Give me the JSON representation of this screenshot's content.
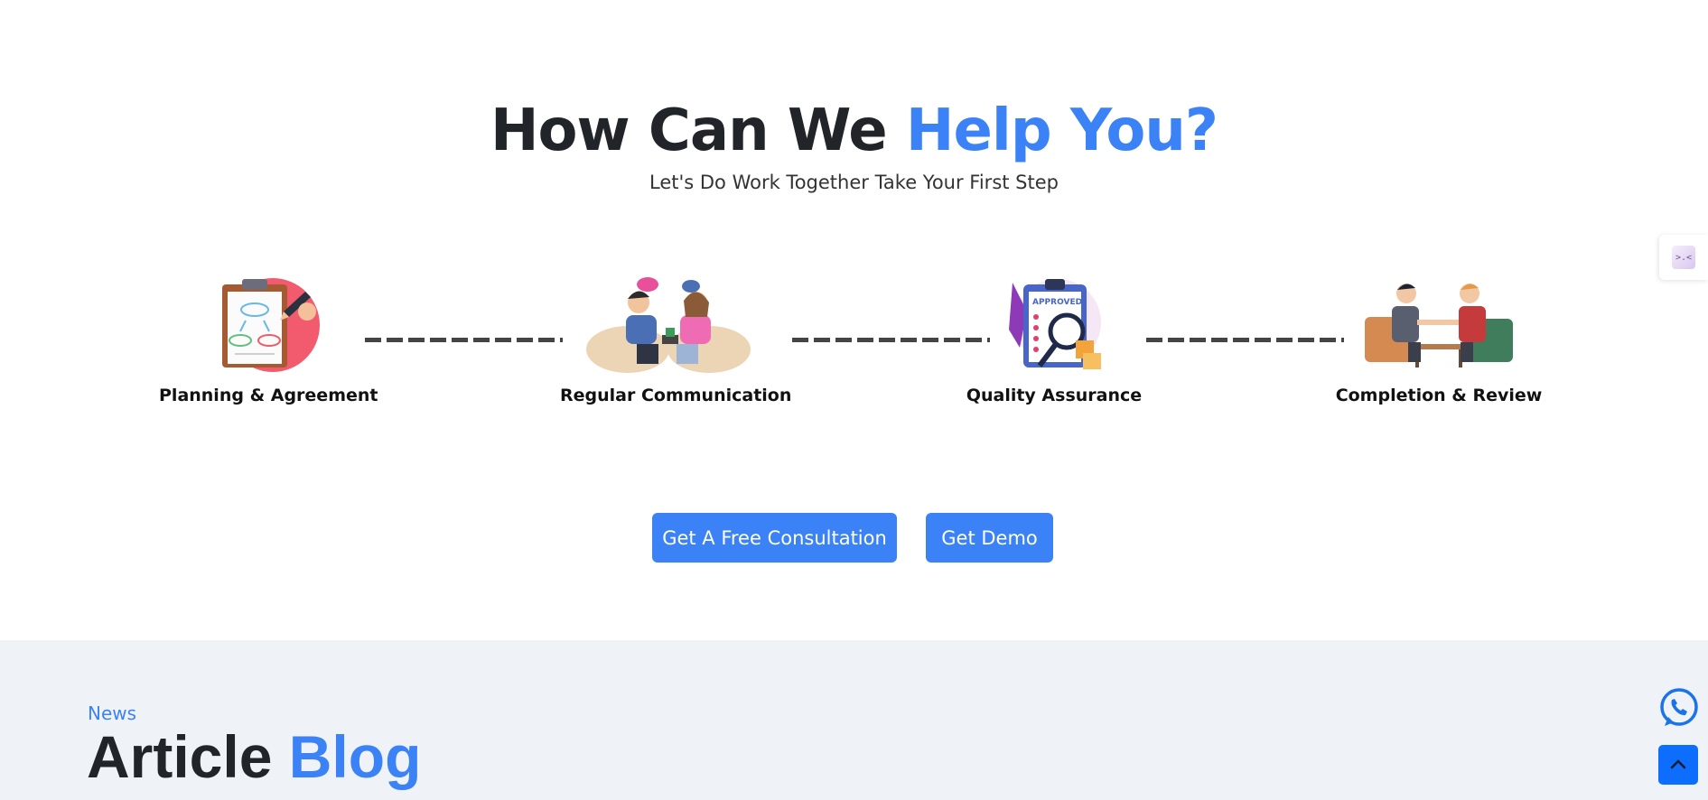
{
  "hero": {
    "title_main": "How Can We ",
    "title_accent": "Help You?",
    "subtitle": "Let's Do Work Together Take Your First Step"
  },
  "steps": [
    {
      "label": "Planning & Agreement",
      "icon": "clipboard-planning-icon"
    },
    {
      "label": "Regular Communication",
      "icon": "people-chatting-icon"
    },
    {
      "label": "Quality Assurance",
      "icon": "approved-checklist-icon"
    },
    {
      "label": "Completion  & Review",
      "icon": "handshake-icon"
    }
  ],
  "buttons": {
    "consultation": "Get A Free Consultation",
    "demo": "Get Demo"
  },
  "news": {
    "eyebrow": "News",
    "title_main": "Article ",
    "title_accent": "Blog"
  },
  "floating": {
    "side_tab_glyph": ">.<",
    "whatsapp_icon": "whatsapp-icon",
    "back_to_top_icon": "chevron-up-icon"
  },
  "colors": {
    "accent": "#3b82f6",
    "button": "#3b82f6",
    "back_to_top": "#0d6efd",
    "news_bg": "#eff3f8"
  }
}
